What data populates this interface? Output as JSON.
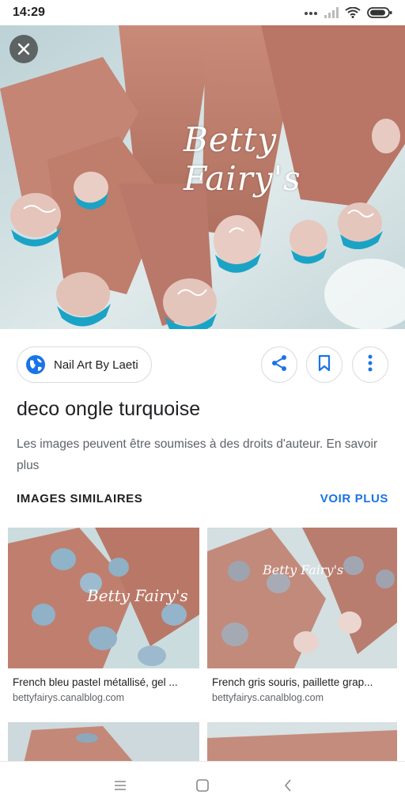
{
  "status_bar": {
    "time": "14:29",
    "icons": [
      "more-dots-icon",
      "signal-icon",
      "wifi-icon",
      "battery-icon"
    ]
  },
  "viewer": {
    "close_icon": "close-icon",
    "hero_watermark": "Betty Fairy's"
  },
  "source": {
    "icon": "globe-icon",
    "label": "Nail Art By Laeti"
  },
  "actions": [
    "share-icon",
    "bookmark-icon",
    "more-vert-icon"
  ],
  "result": {
    "title": "deco ongle turquoise",
    "copyright": "Les images peuvent être soumises à des droits d'auteur. En savoir plus"
  },
  "similar": {
    "heading": "IMAGES SIMILAIRES",
    "see_more": "VOIR PLUS",
    "items": [
      {
        "title": "French bleu pastel métallisé, gel ...",
        "domain": "bettyfairys.canalblog.com",
        "watermark": "Betty Fairy's"
      },
      {
        "title": "French gris souris, paillette grap...",
        "domain": "bettyfairys.canalblog.com",
        "watermark": "Betty Fairy's"
      }
    ]
  },
  "nav_bar": {
    "icons": [
      "menu-icon",
      "home-square-icon",
      "back-chevron-icon"
    ]
  },
  "colors": {
    "accent": "#1a73e8",
    "turquoise_nail": "#1ba3c6",
    "text_primary": "#202124",
    "text_secondary": "#5f6368"
  }
}
